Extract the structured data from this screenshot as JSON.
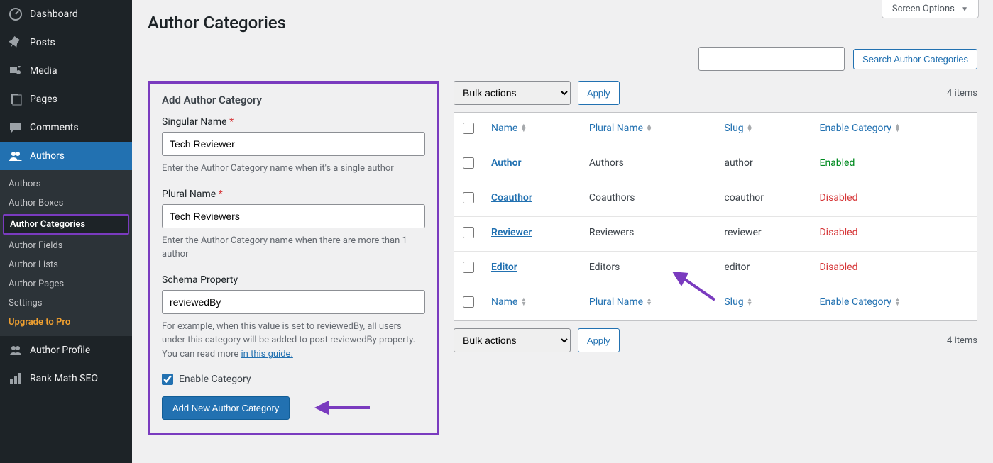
{
  "screen_options": "Screen Options",
  "page_title": "Author Categories",
  "sidebar": {
    "items": [
      {
        "label": "Dashboard",
        "icon": "dashboard"
      },
      {
        "label": "Posts",
        "icon": "pin"
      },
      {
        "label": "Media",
        "icon": "media"
      },
      {
        "label": "Pages",
        "icon": "page"
      },
      {
        "label": "Comments",
        "icon": "comment"
      },
      {
        "label": "Authors",
        "icon": "authors",
        "active": true
      },
      {
        "label": "Author Profile",
        "icon": "profile"
      },
      {
        "label": "Rank Math SEO",
        "icon": "seo"
      }
    ],
    "submenu": [
      {
        "label": "Authors"
      },
      {
        "label": "Author Boxes"
      },
      {
        "label": "Author Categories",
        "current": true
      },
      {
        "label": "Author Fields"
      },
      {
        "label": "Author Lists"
      },
      {
        "label": "Author Pages"
      },
      {
        "label": "Settings"
      },
      {
        "label": "Upgrade to Pro",
        "upgrade": true
      }
    ]
  },
  "search": {
    "button": "Search Author Categories"
  },
  "form": {
    "heading": "Add Author Category",
    "singular_label": "Singular Name",
    "singular_value": "Tech Reviewer",
    "singular_help": "Enter the Author Category name when it's a single author",
    "plural_label": "Plural Name",
    "plural_value": "Tech Reviewers",
    "plural_help": "Enter the Author Category name when there are more than 1 author",
    "schema_label": "Schema Property",
    "schema_value": "reviewedBy",
    "schema_help_pre": "For example, when this value is set to reviewedBy, all users under this category will be added to post reviewedBy property. You can read more ",
    "schema_help_link": "in this guide.",
    "enable_label": "Enable Category",
    "submit": "Add New Author Category"
  },
  "table": {
    "bulk_label": "Bulk actions",
    "apply": "Apply",
    "count": "4 items",
    "cols": {
      "name": "Name",
      "plural": "Plural Name",
      "slug": "Slug",
      "enable": "Enable Category"
    },
    "rows": [
      {
        "name": "Author",
        "plural": "Authors",
        "slug": "author",
        "status": "Enabled",
        "status_class": "enabled"
      },
      {
        "name": "Coauthor",
        "plural": "Coauthors",
        "slug": "coauthor",
        "status": "Disabled",
        "status_class": "disabled"
      },
      {
        "name": "Reviewer",
        "plural": "Reviewers",
        "slug": "reviewer",
        "status": "Disabled",
        "status_class": "disabled"
      },
      {
        "name": "Editor",
        "plural": "Editors",
        "slug": "editor",
        "status": "Disabled",
        "status_class": "disabled"
      }
    ]
  }
}
